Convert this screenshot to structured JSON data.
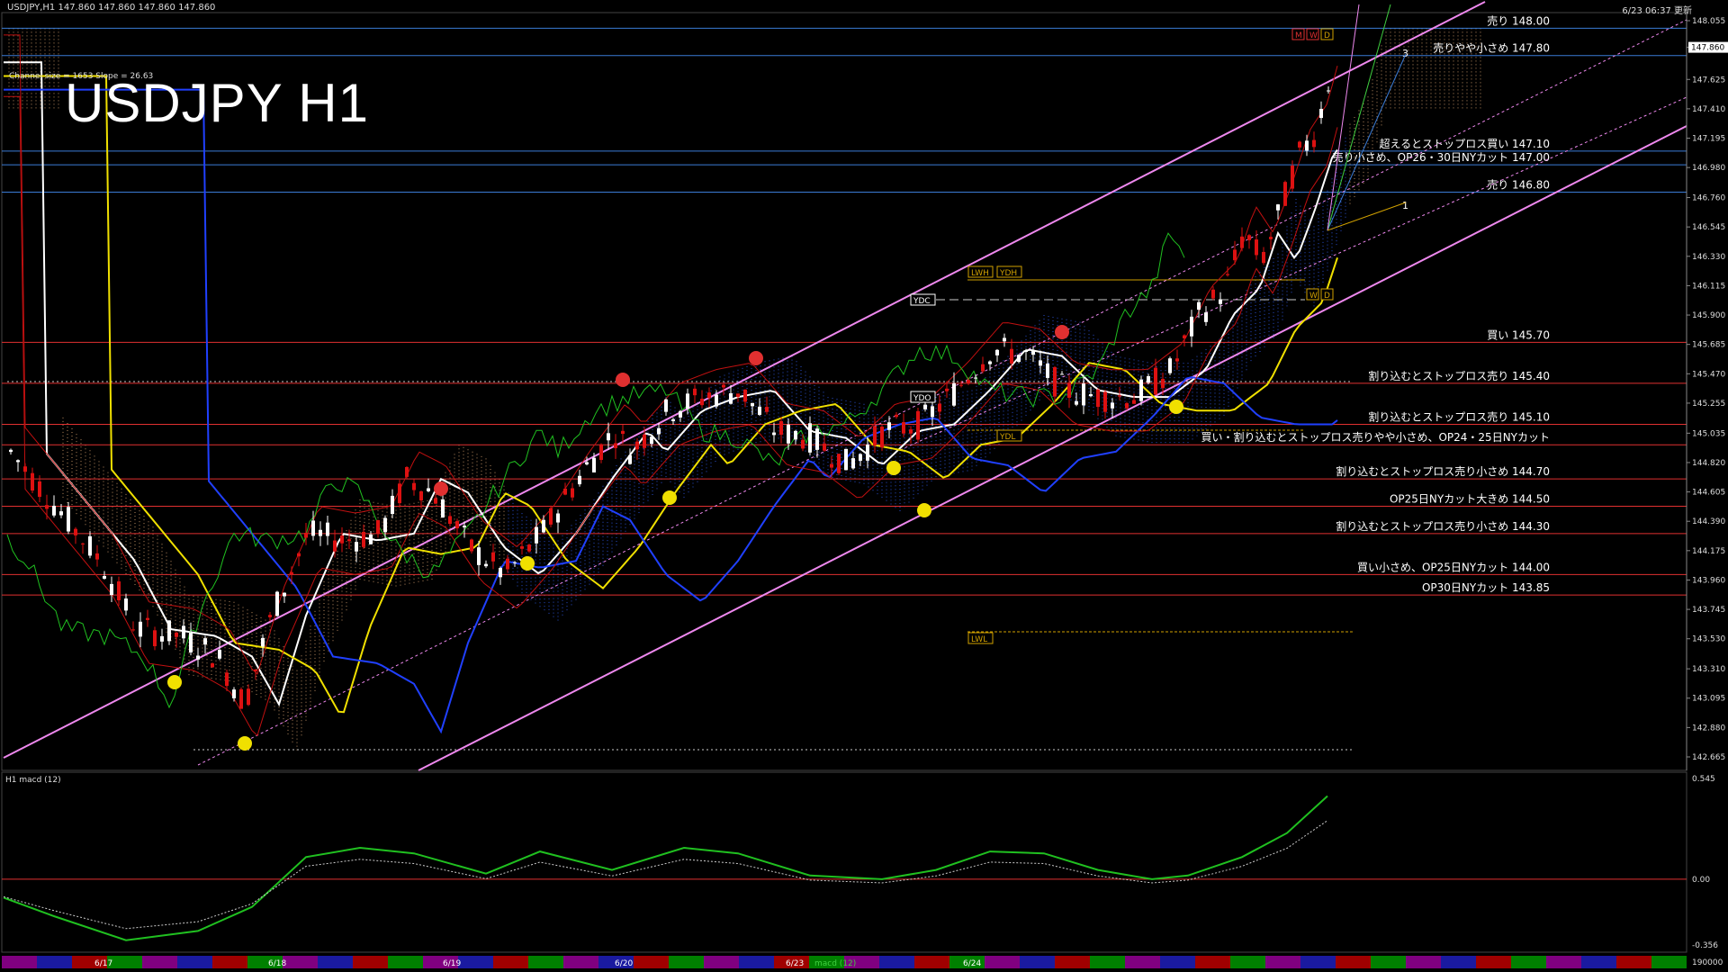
{
  "header": {
    "symbol_info": "USDJPY,H1  147.860 147.860 147.860 147.860",
    "datetime": "6/23 06:37 更新",
    "channel_info": "Channel size = 1653 Slope = 26.63",
    "title": "USDJPY H1"
  },
  "price_axis": {
    "ticks": [
      "148.055",
      "147.860",
      "147.625",
      "147.410",
      "147.195",
      "146.980",
      "146.760",
      "146.545",
      "146.330",
      "146.115",
      "145.900",
      "145.685",
      "145.470",
      "145.255",
      "145.035",
      "144.820",
      "144.605",
      "144.390",
      "144.175",
      "143.960",
      "143.745",
      "143.530",
      "143.310",
      "143.095",
      "142.880",
      "142.665"
    ],
    "current_price": "147.860"
  },
  "levels": [
    {
      "label": "売り 148.00",
      "price": 148.0,
      "color": "#3a7bd5"
    },
    {
      "label": "売りやや小さめ 147.80",
      "price": 147.8,
      "color": "#3a7bd5"
    },
    {
      "label": "超えるとストップロス買い 147.10",
      "price": 147.1,
      "color": "#3a7bd5"
    },
    {
      "label": "売り小さめ、OP26・30日NYカット 147.00",
      "price": 147.0,
      "color": "#3a7bd5"
    },
    {
      "label": "売り 146.80",
      "price": 146.8,
      "color": "#3a7bd5"
    },
    {
      "label": "買い 145.70",
      "price": 145.7,
      "color": "#e03030"
    },
    {
      "label": "割り込むとストップロス売り 145.40",
      "price": 145.4,
      "color": "#e03030"
    },
    {
      "label": "割り込むとストップロス売り 145.10",
      "price": 145.1,
      "color": "#e03030"
    },
    {
      "label": "買い・割り込むとストップロス売りやや小さめ、OP24・25日NYカット",
      "price": 144.95,
      "color": "#e03030"
    },
    {
      "label": "割り込むとストップロス売り小さめ 144.70",
      "price": 144.7,
      "color": "#e03030"
    },
    {
      "label": "OP25日NYカット大きめ 144.50",
      "price": 144.5,
      "color": "#e03030"
    },
    {
      "label": "割り込むとストップロス売り小さめ 144.30",
      "price": 144.3,
      "color": "#e03030"
    },
    {
      "label": "買い小さめ、OP25日NYカット 144.00",
      "price": 144.0,
      "color": "#e03030"
    },
    {
      "label": "OP30日NYカット 143.85",
      "price": 143.85,
      "color": "#e03030"
    }
  ],
  "markers": {
    "ydc": "YDC",
    "ydo": "YDO",
    "ydl": "YDL",
    "lwh": "LWH",
    "ydh": "YDH",
    "lwl": "LWL",
    "mwd": [
      "M",
      "W",
      "D"
    ],
    "wd": [
      "W",
      "D"
    ],
    "fib_1": "1",
    "fib_3": "3"
  },
  "macd": {
    "label": "H1  macd (12)",
    "ticks": [
      "0.545",
      "0.00",
      "-0.356"
    ],
    "scale_label": "190000"
  },
  "date_bar": {
    "dates": [
      "6/17",
      "6/18",
      "6/19",
      "6/20",
      "6/23",
      "6/24"
    ],
    "hidden_label": "macd (12)"
  },
  "colors": {
    "bg": "#000000",
    "up_candle": "#ffffff",
    "down_candle": "#dd1111",
    "channel": "#ee88ee",
    "ma_white": "#ffffff",
    "ma_yellow": "#f0e000",
    "ma_blue": "#2040ff",
    "green": "#20c020",
    "blue_level": "#3a7bd5",
    "red_level": "#e03030",
    "grid": "#101010"
  }
}
